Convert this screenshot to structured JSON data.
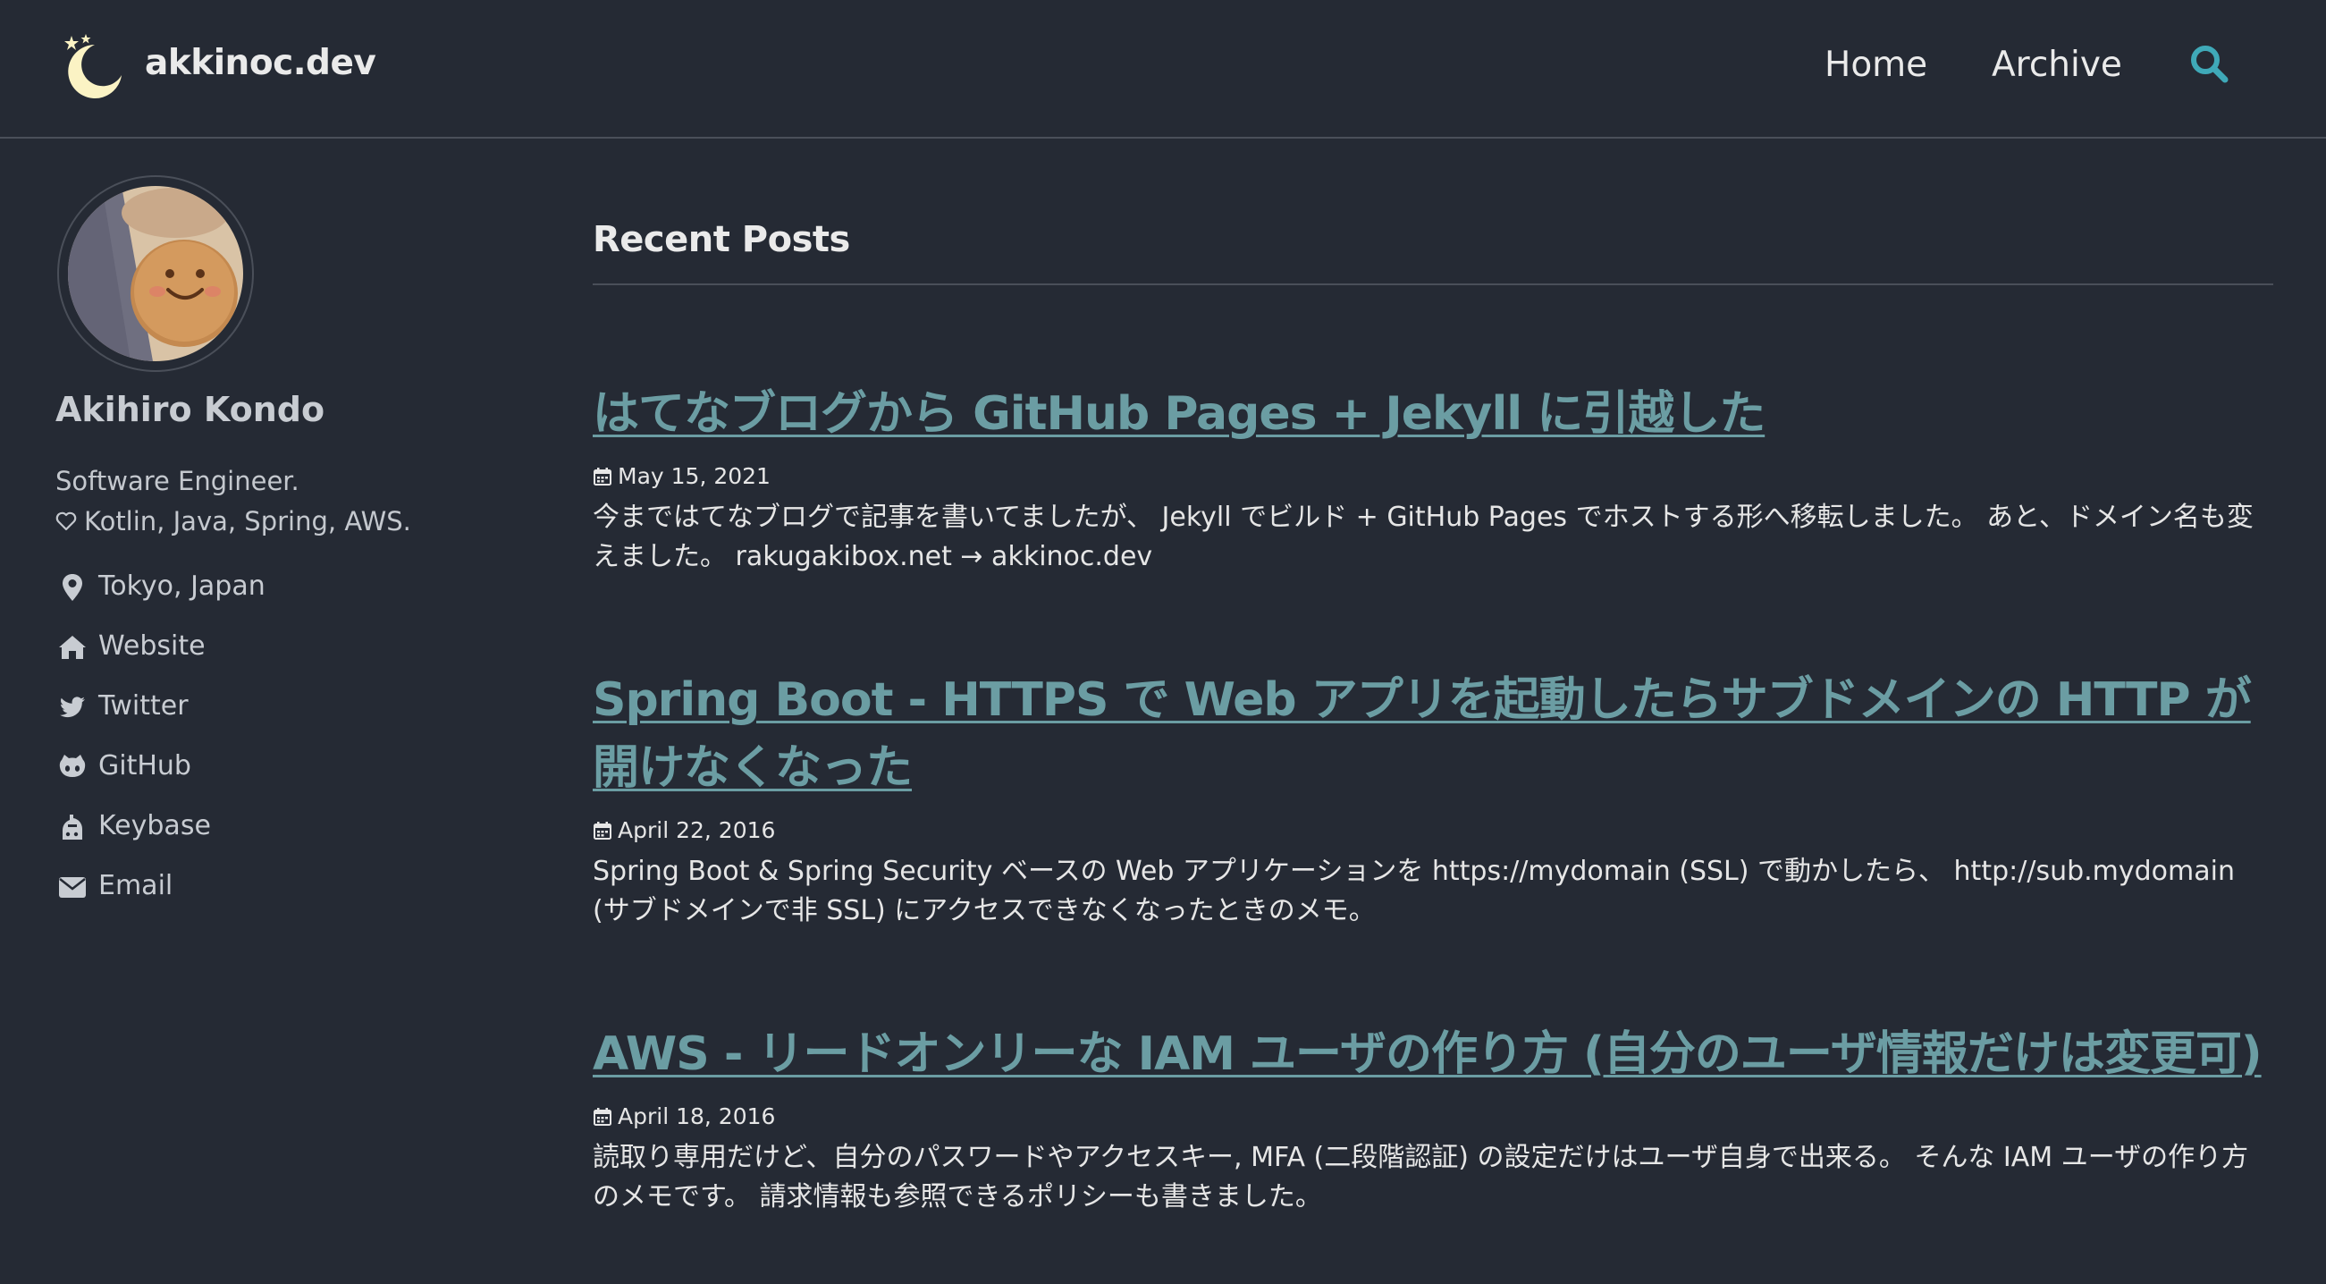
{
  "site": {
    "title": "akkinoc.dev",
    "logo_icon": "moon-stars-icon"
  },
  "nav": {
    "items": [
      {
        "label": "Home"
      },
      {
        "label": "Archive"
      }
    ],
    "search_icon": "search-icon"
  },
  "author": {
    "name": "Akihiro Kondo",
    "bio_line1": "Software Engineer.",
    "bio_line2": "Kotlin, Java, Spring, AWS.",
    "links": [
      {
        "icon": "map-marker-icon",
        "label": "Tokyo, Japan"
      },
      {
        "icon": "home-icon",
        "label": "Website"
      },
      {
        "icon": "twitter-icon",
        "label": "Twitter"
      },
      {
        "icon": "github-icon",
        "label": "GitHub"
      },
      {
        "icon": "keybase-icon",
        "label": "Keybase"
      },
      {
        "icon": "envelope-icon",
        "label": "Email"
      }
    ]
  },
  "main": {
    "section_title": "Recent Posts",
    "posts": [
      {
        "title": "はてなブログから GitHub Pages + Jekyll に引越した",
        "date": "May 15, 2021",
        "excerpt": "今まではてなブログで記事を書いてましたが、 Jekyll でビルド + GitHub Pages でホストする形へ移転しました。 あと、ドメイン名も変えました。 rakugakibox.net → akkinoc.dev"
      },
      {
        "title": "Spring Boot - HTTPS で Web アプリを起動したらサブドメインの HTTP が開けなくなった",
        "date": "April 22, 2016",
        "excerpt": "Spring Boot & Spring Security ベースの Web アプリケーションを https://mydomain (SSL) で動かしたら、 http://sub.mydomain (サブドメインで非 SSL) にアクセスできなくなったときのメモ。"
      },
      {
        "title": "AWS - リードオンリーな IAM ユーザの作り方 (自分のユーザ情報だけは変更可)",
        "date": "April 18, 2016",
        "excerpt": "読取り専用だけど、自分のパスワードやアクセスキー, MFA (二段階認証) の設定だけはユーザ自身で出来る。 そんな IAM ユーザの作り方のメモです。 請求情報も参照できるポリシーも書きました。"
      }
    ]
  },
  "colors": {
    "background": "#252a34",
    "link": "#6b9da3",
    "accent_search": "#3fa9b8",
    "text": "#e6e6e6",
    "divider": "#4a4f59"
  }
}
